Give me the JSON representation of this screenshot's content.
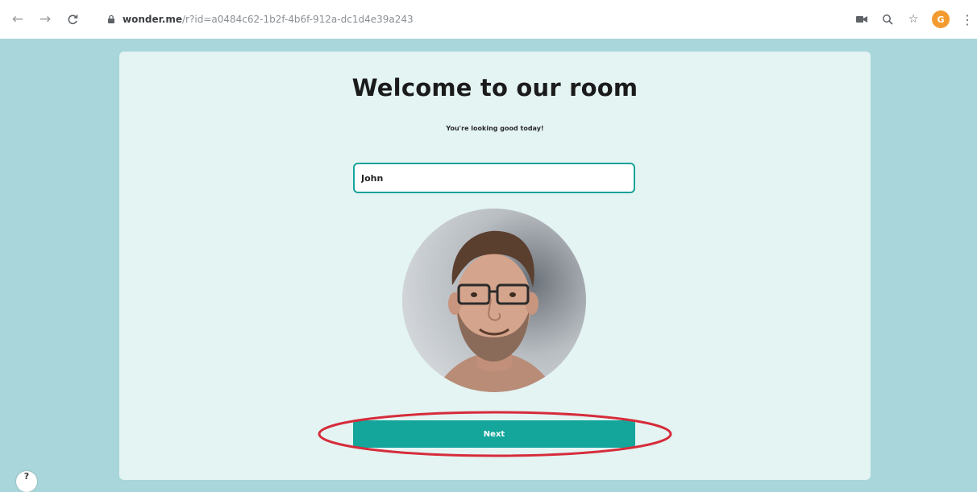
{
  "browser": {
    "url_host": "wonder.me",
    "url_path": "/r?id=a0484c62-1b2f-4b6f-912a-dc1d4e39a243",
    "avatar_initial": "G",
    "menu_glyph": "⋮"
  },
  "page": {
    "title": "Welcome to our room",
    "subtitle": "You're looking good today!",
    "name_value": "John",
    "next_label": "Next"
  },
  "colors": {
    "page_bg": "#a9d6da",
    "card_bg": "#e4f4f3",
    "accent": "#14a59b",
    "annotation": "#d62c3a"
  }
}
